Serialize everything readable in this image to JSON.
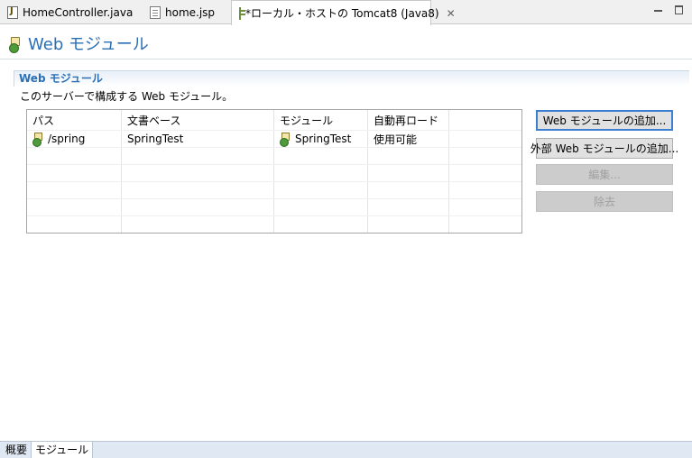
{
  "tabs": [
    {
      "label": "HomeController.java",
      "icon": "java-file-icon"
    },
    {
      "label": "home.jsp",
      "icon": "jsp-file-icon"
    },
    {
      "label": "*ローカル・ホストの Tomcat8 (Java8)",
      "icon": "server-icon",
      "active": true
    }
  ],
  "editor": {
    "title": "Web モジュール"
  },
  "section": {
    "title": "Web モジュール",
    "description": "このサーバーで構成する Web モジュール。"
  },
  "table": {
    "columns": [
      "パス",
      "文書ベース",
      "モジュール",
      "自動再ロード"
    ],
    "rows": [
      {
        "path": "/spring",
        "doc_base": "SpringTest",
        "module": "SpringTest",
        "auto_reload": "使用可能"
      }
    ]
  },
  "buttons": {
    "add_web_module": "Web モジュールの追加...",
    "add_external_module": "外部 Web モジュールの追加...",
    "edit": "編集...",
    "remove": "除去"
  },
  "bottom_tabs": [
    {
      "label": "概要"
    },
    {
      "label": "モジュール",
      "active": true
    }
  ],
  "colors": {
    "accent": "#2a6fb5",
    "focus_border": "#3c7fd1"
  }
}
